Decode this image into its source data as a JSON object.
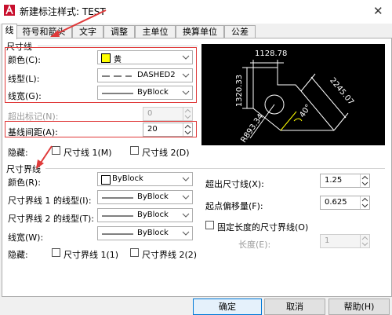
{
  "title": "新建标注样式: TEST",
  "tabs": [
    "线",
    "符号和箭头",
    "文字",
    "调整",
    "主单位",
    "换算单位",
    "公差"
  ],
  "dim_line": {
    "group": "尺寸线",
    "color_label": "颜色(C):",
    "color_value": "黄",
    "linetype_label": "线型(L):",
    "linetype_value": "DASHED2",
    "lineweight_label": "线宽(G):",
    "lineweight_value": "ByBlock",
    "extend_label": "超出标记(N):",
    "extend_value": "0",
    "spacing_label": "基线间距(A):",
    "spacing_value": "20",
    "suppress_label": "隐藏:",
    "suppress_1": "尺寸线 1(M)",
    "suppress_2": "尺寸线 2(D)"
  },
  "ext_line": {
    "group": "尺寸界线",
    "color_label": "颜色(R):",
    "color_value": "ByBlock",
    "lt1_label": "尺寸界线 1 的线型(I):",
    "lt1_value": "ByBlock",
    "lt2_label": "尺寸界线 2 的线型(T):",
    "lt2_value": "ByBlock",
    "lineweight_label": "线宽(W):",
    "lineweight_value": "ByBlock",
    "suppress_label": "隐藏:",
    "suppress_1": "尺寸界线 1(1)",
    "suppress_2": "尺寸界线 2(2)",
    "beyond_label": "超出尺寸线(X):",
    "beyond_value": "1.25",
    "offset_label": "起点偏移量(F):",
    "offset_value": "0.625",
    "fixed_label": "固定长度的尺寸界线(O)",
    "length_label": "长度(E):",
    "length_value": "1"
  },
  "preview": {
    "top": "1128.78",
    "left": "1320.33",
    "diag": "2245.07",
    "angle": "40°",
    "radius": "R893.34"
  },
  "buttons": {
    "ok": "确定",
    "cancel": "取消",
    "help": "帮助(H)"
  },
  "colors": {
    "yellow": "#ffff00",
    "preview_bg": "#000000",
    "red_highlight": "#e03a3a"
  }
}
